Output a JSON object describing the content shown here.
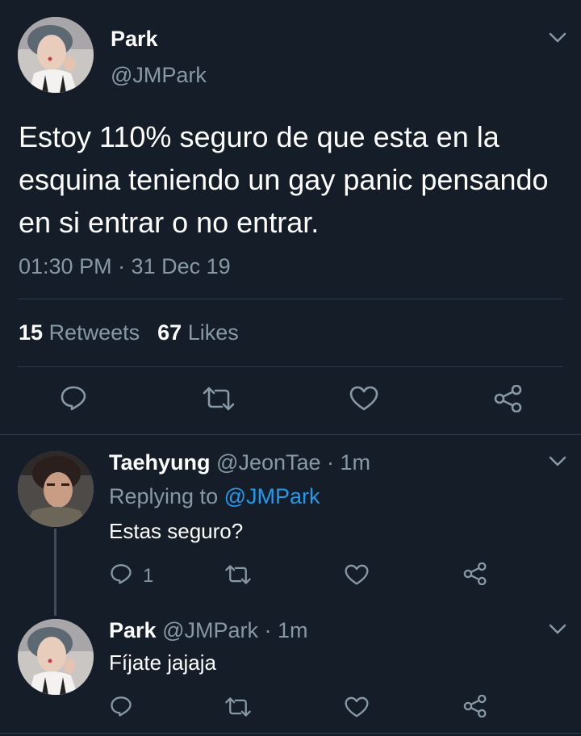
{
  "colors": {
    "background": "#151d29",
    "muted_text": "#8899a6",
    "link": "#1d9bf0",
    "divider": "#2e3b4a"
  },
  "main_tweet": {
    "name": "Park",
    "handle": "@JMPark",
    "text": "Estoy 110% seguro de que esta en la esquina teniendo un gay panic pensando en si entrar o no entrar.",
    "time": "01:30 PM · 31 Dec 19",
    "retweet_count": "15",
    "retweet_label": "Retweets",
    "like_count": "67",
    "like_label": "Likes",
    "actions": [
      "reply-icon",
      "retweet-icon",
      "like-icon",
      "share-icon"
    ]
  },
  "replies": [
    {
      "name": "Taehyung",
      "handle": "@JeonTae",
      "time": "· 1m",
      "replying_label": "Replying to",
      "replying_handle": "@JMPark",
      "text": "Estas seguro?",
      "reply_count": "1"
    },
    {
      "name": "Park",
      "handle": "@JMPark",
      "time": "· 1m",
      "text": "Fíjate jajaja"
    }
  ]
}
